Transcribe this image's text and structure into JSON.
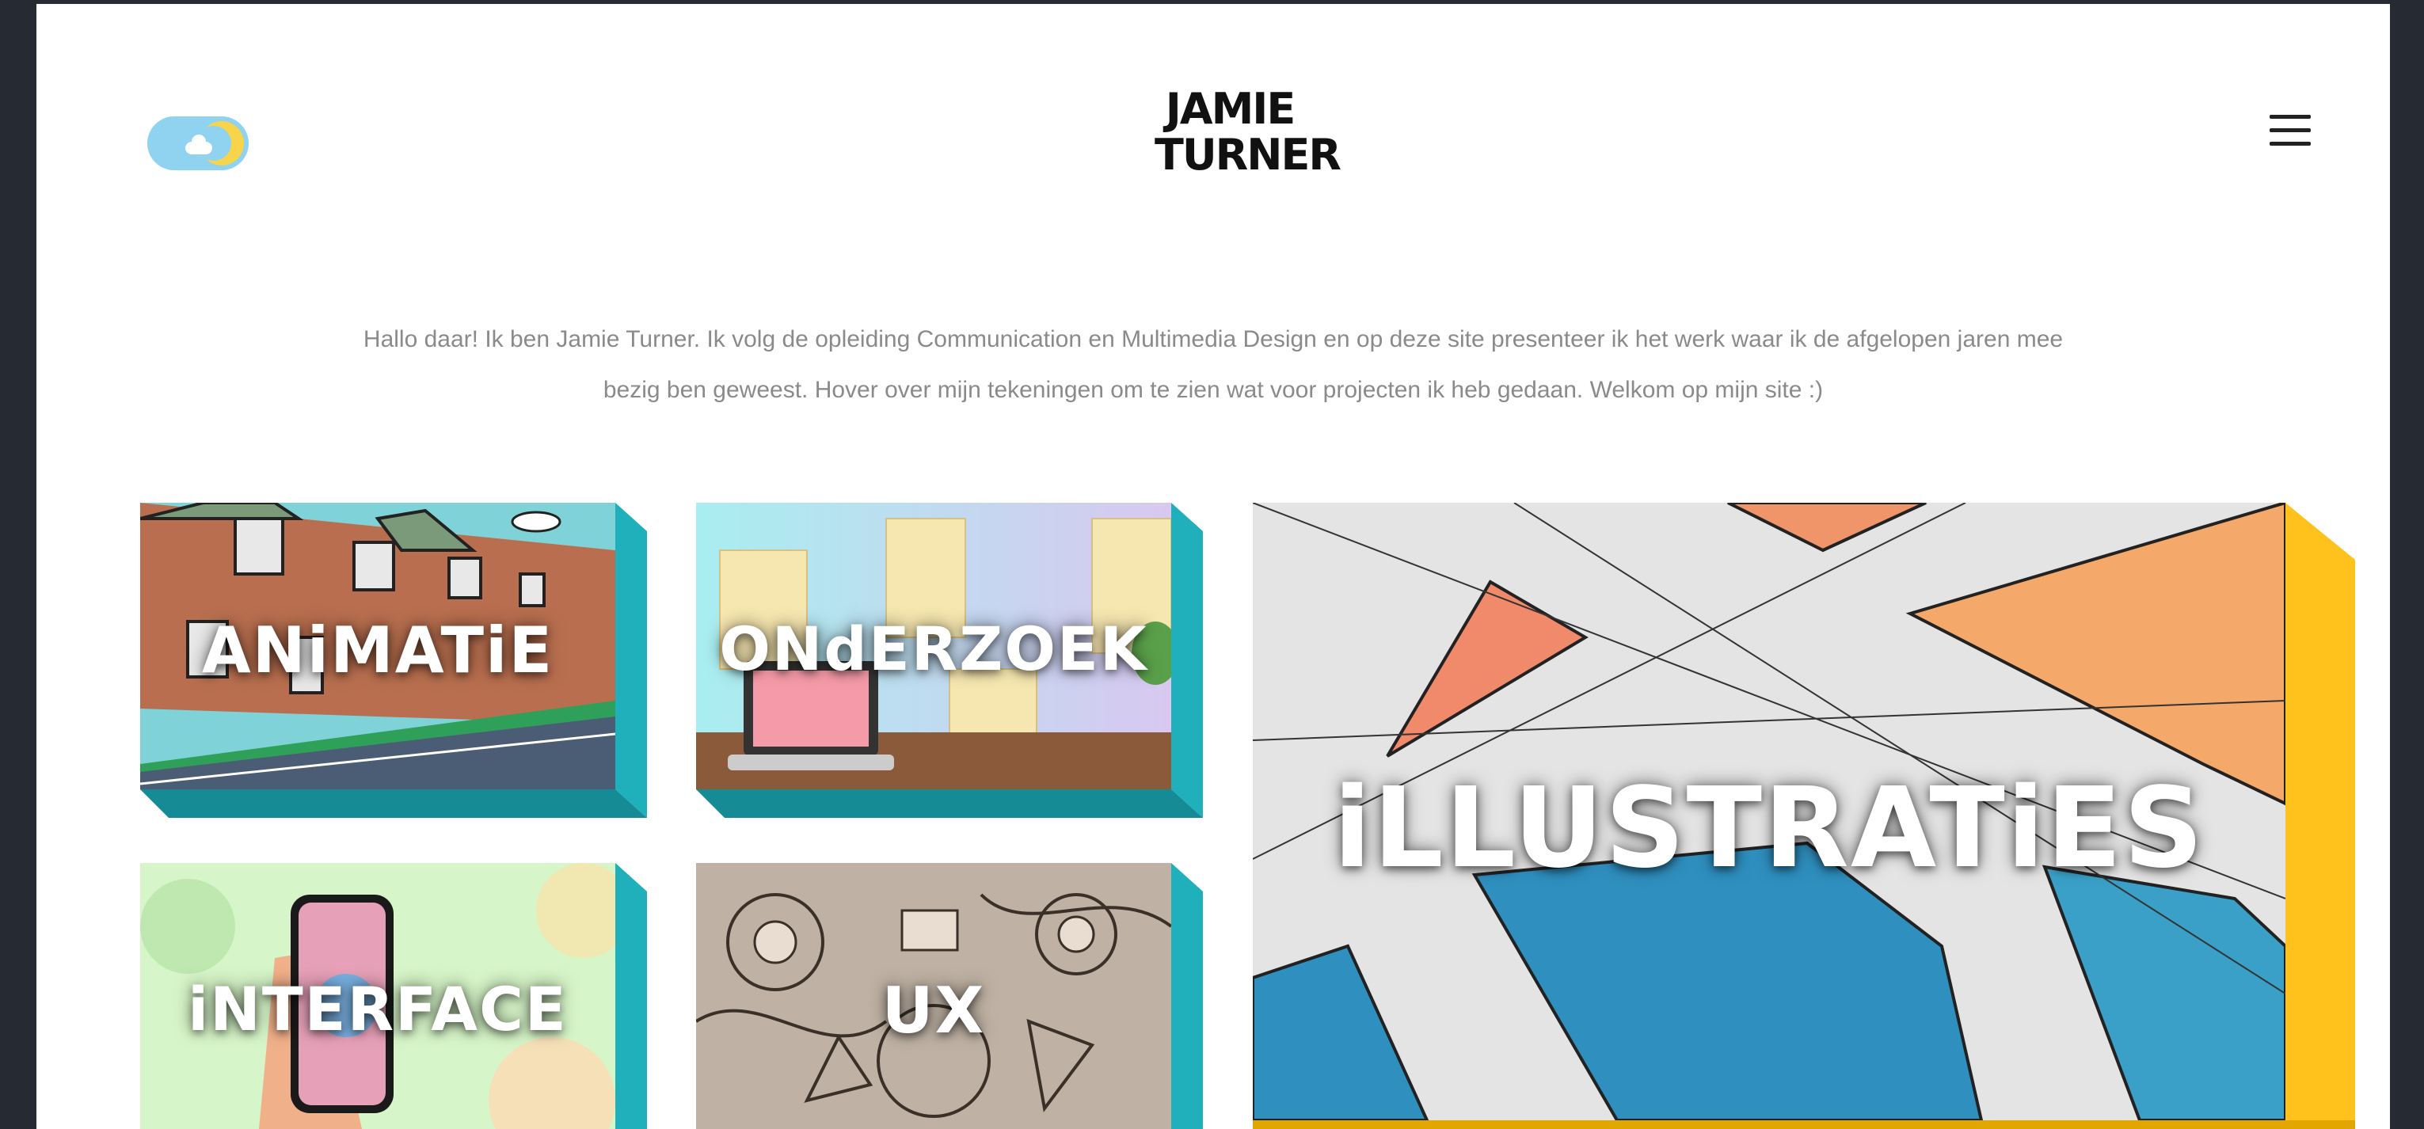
{
  "header": {
    "logo_line1": "JAMIE",
    "logo_line2": "TURNER",
    "toggle_icon": "sun-cloud-icon",
    "menu_icon": "hamburger-menu-icon"
  },
  "intro": {
    "line1": "Hallo daar! Ik ben Jamie Turner. Ik volg de opleiding Communication en Multimedia Design en op deze site presenteer ik het werk waar ik de afgelopen jaren mee",
    "line2": "bezig ben geweest. Hover over mijn tekeningen om te zien wat voor projecten ik heb gedaan. Welkom op mijn site :)"
  },
  "cards": {
    "animatie": "ANiMATiE",
    "onderzoek": "ONdERZOEK",
    "illustraties": "iLLUSTRATiES",
    "interface": "iNTERFACE",
    "ux": "UX"
  },
  "colors": {
    "background": "#262b33",
    "card_side_teal": "#1fb0bb",
    "card_side_yellow": "#ffc21c",
    "toggle": "#8fd3f0"
  }
}
